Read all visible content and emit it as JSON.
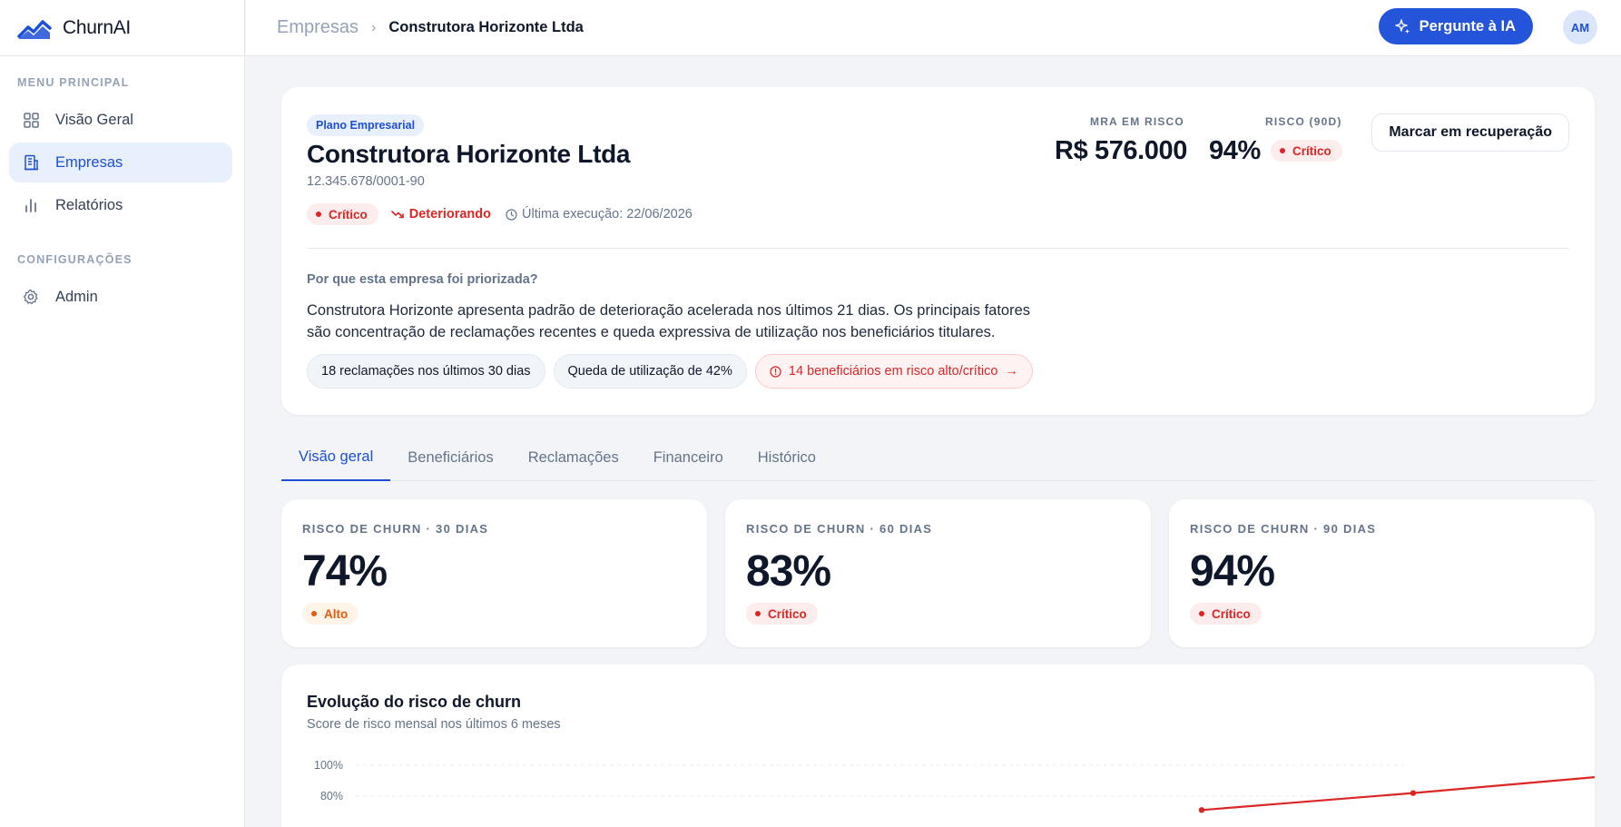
{
  "app": {
    "name": "ChurnAI"
  },
  "sidebar": {
    "sections": [
      {
        "title": "MENU PRINCIPAL"
      },
      {
        "title": "CONFIGURAÇÕES"
      }
    ],
    "items": [
      {
        "label": "Visão Geral",
        "icon": "grid-icon"
      },
      {
        "label": "Empresas",
        "icon": "building-icon",
        "active": true
      },
      {
        "label": "Relatórios",
        "icon": "bar-chart-icon"
      },
      {
        "label": "Admin",
        "icon": "gear-icon"
      }
    ]
  },
  "header": {
    "breadcrumb_root": "Empresas",
    "breadcrumb_current": "Construtora Horizonte Ltda",
    "ask_ai_label": "Pergunte à IA",
    "avatar_initials": "AM"
  },
  "company": {
    "plan": "Plano Empresarial",
    "name": "Construtora Horizonte Ltda",
    "cnpj": "12.345.678/0001-90",
    "status": "Crítico",
    "trend": "Deteriorando",
    "last_run": "Última execução: 22/06/2026",
    "mra_label": "MRA EM RISCO",
    "mra_value": "R$ 576.000",
    "risk_label": "RISCO (90D)",
    "risk_value": "94%",
    "risk_status": "Crítico",
    "recover_button": "Marcar em recuperação",
    "why_title": "Por que esta empresa foi priorizada?",
    "why_text": "Construtora Horizonte apresenta padrão de deterioração acelerada nos últimos 21 dias. Os principais fatores são concentração de reclamações recentes e queda expressiva de utilização nos beneficiários titulares.",
    "chips": [
      "18 reclamações nos últimos 30 dias",
      "Queda de utilização de 42%",
      "14 beneficiários em risco alto/crítico"
    ]
  },
  "tabs": [
    "Visão geral",
    "Beneficiários",
    "Reclamações",
    "Financeiro",
    "Histórico"
  ],
  "risk_cards": [
    {
      "label": "RISCO DE CHURN · 30 DIAS",
      "value": "74%",
      "status": "Alto",
      "status_color": "#ea580c"
    },
    {
      "label": "RISCO DE CHURN · 60 DIAS",
      "value": "83%",
      "status": "Crítico",
      "status_color": "#dc2626"
    },
    {
      "label": "RISCO DE CHURN · 90 DIAS",
      "value": "94%",
      "status": "Crítico",
      "status_color": "#dc2626"
    }
  ],
  "chart": {
    "title": "Evolução do risco de churn",
    "subtitle": "Score de risco mensal nos últimos 6 meses"
  },
  "chart_data": {
    "type": "line",
    "ytick_labels": [
      "100%",
      "80%"
    ],
    "ylim": [
      0,
      100
    ],
    "grid": true,
    "series_color": "#dc2626",
    "x": [
      4,
      5,
      6
    ],
    "values": [
      71,
      82,
      94
    ]
  },
  "colors": {
    "accent": "#2354d9",
    "critical": "#dc2626",
    "high": "#ea580c"
  }
}
